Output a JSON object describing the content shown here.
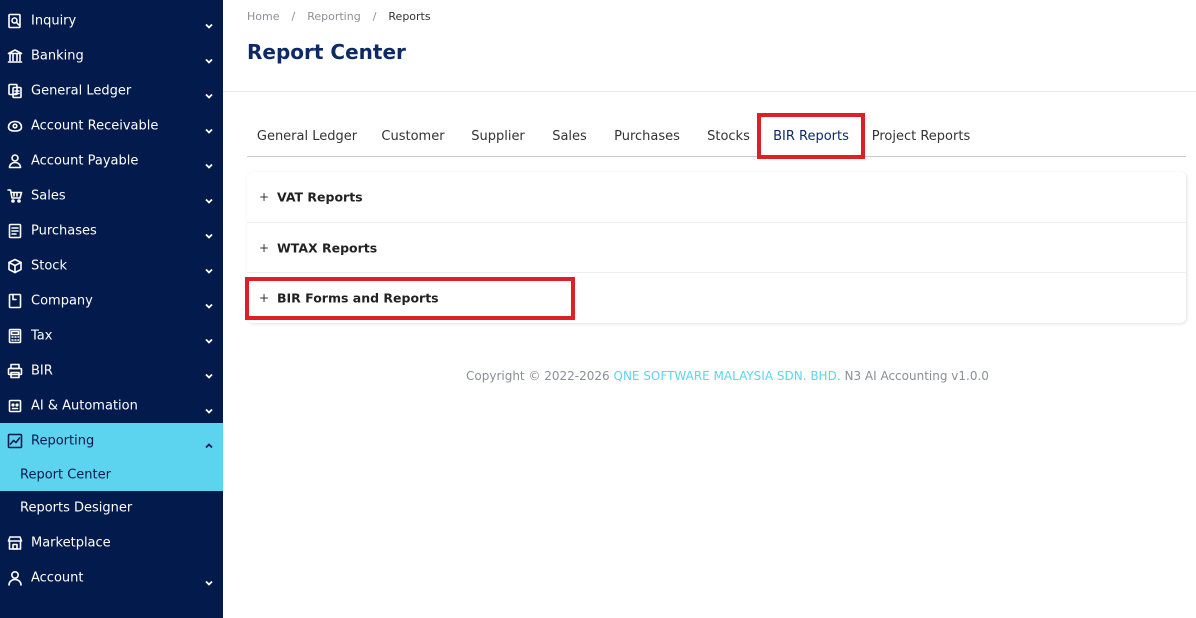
{
  "sidebar": {
    "items": [
      {
        "label": "Inquiry",
        "icon": "inquiry-icon",
        "has_chevron": true
      },
      {
        "label": "Banking",
        "icon": "bank-icon",
        "has_chevron": true
      },
      {
        "label": "General Ledger",
        "icon": "ledger-icon",
        "has_chevron": true
      },
      {
        "label": "Account Receivable",
        "icon": "account-receivable-icon",
        "has_chevron": true
      },
      {
        "label": "Account Payable",
        "icon": "account-payable-icon",
        "has_chevron": true
      },
      {
        "label": "Sales",
        "icon": "cart-icon",
        "has_chevron": true
      },
      {
        "label": "Purchases",
        "icon": "purchases-icon",
        "has_chevron": true
      },
      {
        "label": "Stock",
        "icon": "box-icon",
        "has_chevron": true
      },
      {
        "label": "Company",
        "icon": "company-icon",
        "has_chevron": true
      },
      {
        "label": "Tax",
        "icon": "calculator-icon",
        "has_chevron": true
      },
      {
        "label": "BIR",
        "icon": "printer-icon",
        "has_chevron": true
      },
      {
        "label": "AI & Automation",
        "icon": "robot-icon",
        "has_chevron": true
      },
      {
        "label": "Reporting",
        "icon": "chart-icon",
        "has_chevron": true,
        "expanded": true
      }
    ],
    "sub_items": [
      {
        "label": "Report Center",
        "active": true
      },
      {
        "label": "Reports Designer",
        "active": false
      }
    ],
    "bottom_items": [
      {
        "label": "Marketplace",
        "icon": "store-icon",
        "has_chevron": false
      },
      {
        "label": "Account",
        "icon": "user-icon",
        "has_chevron": true
      }
    ],
    "active_color": "#5dd4ef",
    "background": "#031a4c"
  },
  "breadcrumb": {
    "items": [
      "Home",
      "Reporting",
      "Reports"
    ]
  },
  "page": {
    "title": "Report Center"
  },
  "tabs": {
    "items": [
      "General Ledger",
      "Customer",
      "Supplier",
      "Sales",
      "Purchases",
      "Stocks",
      "BIR Reports",
      "Project Reports"
    ],
    "active": "BIR Reports"
  },
  "accordion": {
    "items": [
      {
        "label": "VAT Reports",
        "toggle": "+"
      },
      {
        "label": "WTAX Reports",
        "toggle": "+"
      },
      {
        "label": "BIR Forms and Reports",
        "toggle": "+"
      }
    ]
  },
  "footer": {
    "prefix": "Copyright © 2022-2026",
    "company": "QNE SOFTWARE MALAYSIA SDN. BHD.",
    "suffix": "N3 AI Accounting v1.0.0"
  },
  "highlight_color": "#e01f24"
}
